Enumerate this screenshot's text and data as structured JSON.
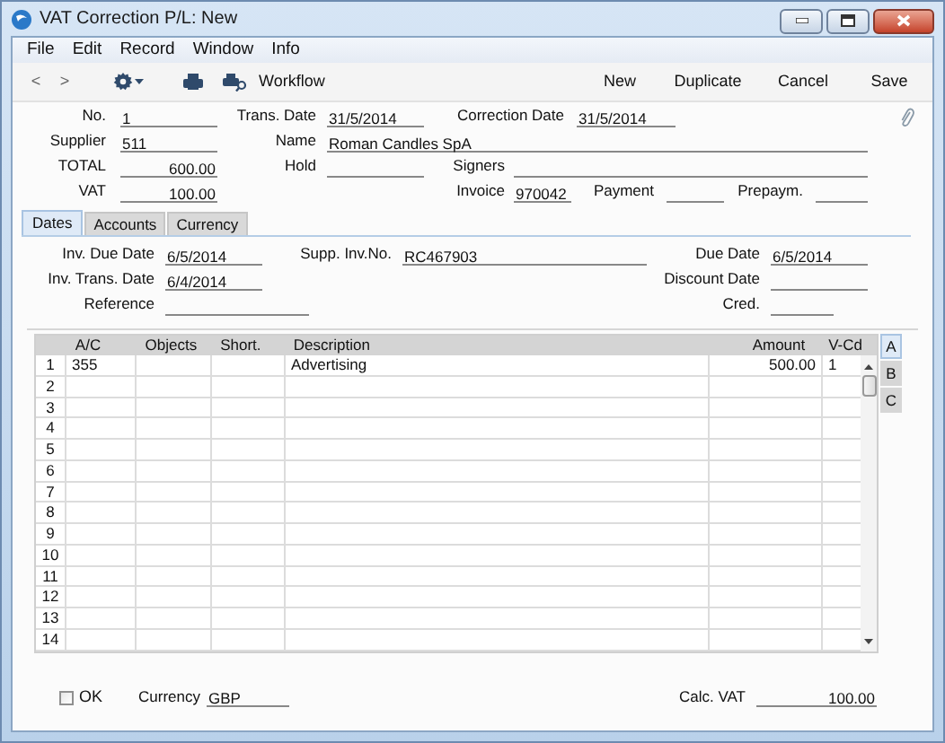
{
  "window": {
    "title": "VAT Correction P/L: New"
  },
  "menu": [
    "File",
    "Edit",
    "Record",
    "Window",
    "Info"
  ],
  "toolbar": {
    "back": "<",
    "forward": ">",
    "workflow": "Workflow",
    "buttons": [
      "New",
      "Duplicate",
      "Cancel",
      "Save"
    ]
  },
  "header": {
    "no": {
      "label": "No.",
      "value": "1"
    },
    "trans_date": {
      "label": "Trans. Date",
      "value": "31/5/2014"
    },
    "correction_date": {
      "label": "Correction Date",
      "value": "31/5/2014"
    },
    "supplier": {
      "label": "Supplier",
      "value": "511"
    },
    "name": {
      "label": "Name",
      "value": "Roman Candles SpA"
    },
    "total": {
      "label": "TOTAL",
      "value": "600.00"
    },
    "hold": {
      "label": "Hold"
    },
    "signers": {
      "label": "Signers"
    },
    "vat": {
      "label": "VAT",
      "value": "100.00"
    },
    "invoice": {
      "label": "Invoice",
      "value": "970042"
    },
    "payment": {
      "label": "Payment"
    },
    "prepaym": {
      "label": "Prepaym."
    }
  },
  "tabs": [
    {
      "label": "Dates",
      "selected": true
    },
    {
      "label": "Accounts",
      "selected": false
    },
    {
      "label": "Currency",
      "selected": false
    }
  ],
  "dates": {
    "inv_due_date": {
      "label": "Inv. Due Date",
      "value": "6/5/2014"
    },
    "supp_inv_no": {
      "label": "Supp. Inv.No.",
      "value": "RC467903"
    },
    "due_date": {
      "label": "Due Date",
      "value": "6/5/2014"
    },
    "inv_trans_date": {
      "label": "Inv. Trans. Date",
      "value": "6/4/2014"
    },
    "discount_date": {
      "label": "Discount Date"
    },
    "reference": {
      "label": "Reference"
    },
    "cred": {
      "label": "Cred."
    }
  },
  "table": {
    "columns": [
      "A/C",
      "Objects",
      "Short.",
      "Description",
      "Amount",
      "V-Cd"
    ],
    "rows": [
      {
        "number": "1",
        "cells": [
          "355",
          "",
          "",
          "Advertising",
          "500.00",
          "1"
        ]
      },
      {
        "number": "2"
      },
      {
        "number": "3"
      },
      {
        "number": "4"
      },
      {
        "number": "5"
      },
      {
        "number": "6"
      },
      {
        "number": "7"
      },
      {
        "number": "8"
      },
      {
        "number": "9"
      },
      {
        "number": "10"
      },
      {
        "number": "11"
      },
      {
        "number": "12"
      },
      {
        "number": "13"
      },
      {
        "number": "14"
      }
    ]
  },
  "side_tabs": [
    {
      "label": "A",
      "selected": true
    },
    {
      "label": "B",
      "selected": false
    },
    {
      "label": "C",
      "selected": false
    }
  ],
  "footer": {
    "ok": {
      "label": "OK",
      "checked": false
    },
    "currency": {
      "label": "Currency",
      "value": "GBP"
    },
    "calc_vat": {
      "label": "Calc. VAT",
      "value": "100.00"
    }
  }
}
